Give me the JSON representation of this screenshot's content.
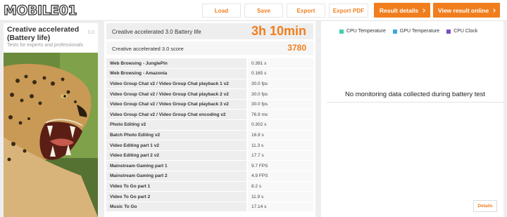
{
  "brand": {
    "logo_text": "MOBILE01"
  },
  "toolbar": {
    "load": "Load",
    "save": "Save",
    "export": "Export",
    "export_pdf": "Export PDF",
    "result_details": "Result details",
    "view_online": "View result online"
  },
  "test": {
    "title": "Creative accelerated (Battery life)",
    "version": "3.0",
    "subtitle": "Tests for experts and professionals"
  },
  "results": {
    "battery_name": "Creative accelerated 3.0 Battery life",
    "battery_value": "3h 10min",
    "score_name": "Creative accelerated 3.0 score",
    "score_value": "3780",
    "subtests": [
      {
        "name": "Web Browsing - JunglePin",
        "value": "0.391 s"
      },
      {
        "name": "Web Browsing - Amazonia",
        "value": "0.165 s"
      },
      {
        "name": "Video Group Chat v2 / Video Group Chat playback 1 v2",
        "value": "30.0 fps"
      },
      {
        "name": "Video Group Chat v2 / Video Group Chat playback 2 v2",
        "value": "30.0 fps"
      },
      {
        "name": "Video Group Chat v2 / Video Group Chat playback 3 v2",
        "value": "30.0 fps"
      },
      {
        "name": "Video Group Chat v2 / Video Group Chat encoding v2",
        "value": "76.9 ms"
      },
      {
        "name": "Photo Editing v2",
        "value": "0.302 s"
      },
      {
        "name": "Batch Photo Editing v2",
        "value": "16.9 s"
      },
      {
        "name": "Video Editing part 1 v2",
        "value": "11.3 s"
      },
      {
        "name": "Video Editing part 2 v2",
        "value": "17.7 s"
      },
      {
        "name": "Mainstream Gaming part 1",
        "value": "9.7 FPS"
      },
      {
        "name": "Mainstream Gaming part 2",
        "value": "4.9 FPS"
      },
      {
        "name": "Video To Go part 1",
        "value": "8.2 s"
      },
      {
        "name": "Video To Go part 2",
        "value": "11.9 s"
      },
      {
        "name": "Music To Go",
        "value": "17.14 s"
      }
    ]
  },
  "monitoring": {
    "legend": [
      {
        "label": "CPU Temperature",
        "color": "#3ecfb2"
      },
      {
        "label": "GPU Temperature",
        "color": "#3aa9e0"
      },
      {
        "label": "CPU Clock",
        "color": "#7a4fc2"
      }
    ],
    "empty_message": "No monitoring data collected during battery test",
    "details": "Details"
  },
  "colors": {
    "accent": "#f07e1e",
    "panel_bg": "#eeeeee"
  }
}
